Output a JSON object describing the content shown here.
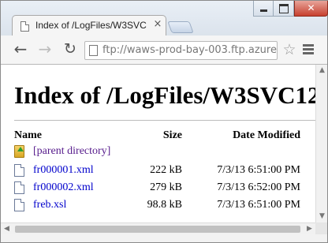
{
  "window": {
    "close_glyph": "✕"
  },
  "tab": {
    "title": "Index of /LogFiles/W3SVC",
    "close_glyph": "×"
  },
  "toolbar": {
    "back_glyph": "←",
    "forward_glyph": "→",
    "reload_glyph": "↻",
    "url": "ftp://waws-prod-bay-003.ftp.azure",
    "star_glyph": "☆"
  },
  "page": {
    "heading": "Index of /LogFiles/W3SVC12",
    "columns": {
      "name": "Name",
      "size": "Size",
      "date": "Date Modified"
    },
    "parent_link": "[parent directory]",
    "files": [
      {
        "name": "fr000001.xml",
        "size": "222 kB",
        "date": "7/3/13 6:51:00 PM"
      },
      {
        "name": "fr000002.xml",
        "size": "279 kB",
        "date": "7/3/13 6:52:00 PM"
      },
      {
        "name": "freb.xsl",
        "size": "98.8 kB",
        "date": "7/3/13 6:51:00 PM"
      }
    ]
  },
  "scrollbar": {
    "up": "▲",
    "down": "▼",
    "left": "◀",
    "right": "▶"
  },
  "icons": {
    "page_icon": "page-icon",
    "file_icon": "file-icon",
    "parent_icon": "parent-directory-icon",
    "menu_icon": "hamburger-menu-icon"
  },
  "colors": {
    "link": "#0000cc",
    "visited_link": "#551a8b",
    "close_button": "#c7402f"
  }
}
